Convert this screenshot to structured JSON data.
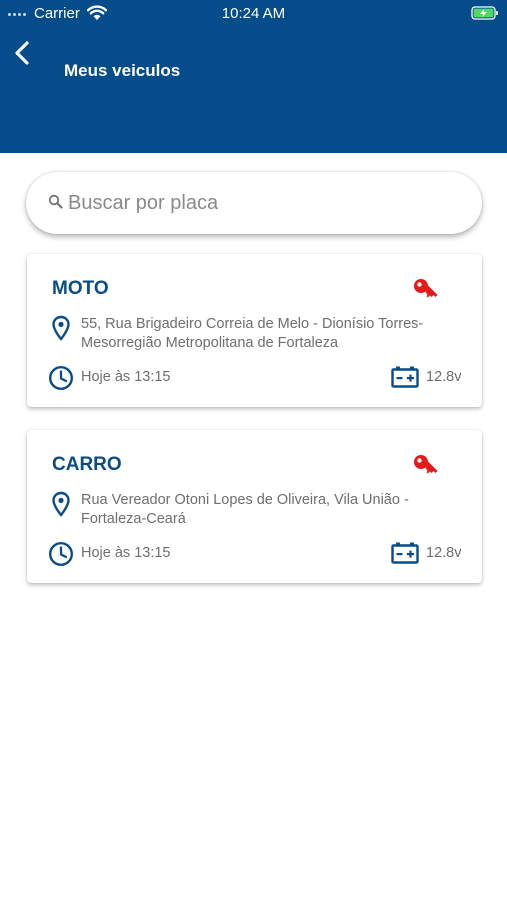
{
  "status_bar": {
    "carrier": "Carrier",
    "time": "10:24 AM",
    "icons": [
      "signal-dots-icon",
      "wifi-icon",
      "battery-charging-icon"
    ]
  },
  "header": {
    "title": "Meus veiculos",
    "back_icon": "chevron-left-icon"
  },
  "search": {
    "placeholder": "Buscar por placa",
    "value": "",
    "icon": "search-icon"
  },
  "vehicles": [
    {
      "name": "MOTO",
      "address": "55, Rua Brigadeiro Correia de Melo - Dionísio Torres-Mesorregião Metropolitana de Fortaleza",
      "time": "Hoje às 13:15",
      "voltage": "12.8v",
      "key_status_color": "#e31b1b"
    },
    {
      "name": "CARRO",
      "address": "Rua Vereador Otoni Lopes de Oliveira, Vila União - Fortaleza-Ceará",
      "time": "Hoje às 13:15",
      "voltage": "12.8v",
      "key_status_color": "#e31b1b"
    }
  ],
  "colors": {
    "header_bg": "#044d8a",
    "accent_text": "#0a4c85",
    "key_red": "#e31b1b",
    "muted_text": "#6e6e6e"
  }
}
